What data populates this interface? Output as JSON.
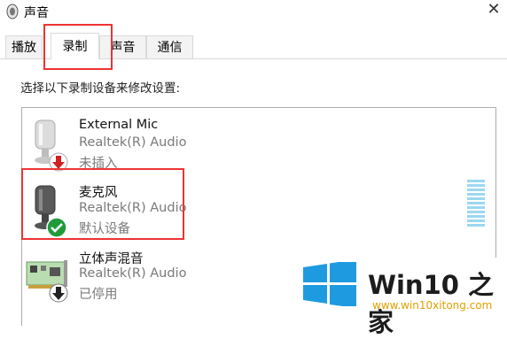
{
  "window": {
    "title": "声音",
    "close_glyph": "✕"
  },
  "tabs": [
    {
      "label": "播放"
    },
    {
      "label": "录制"
    },
    {
      "label": "声音"
    },
    {
      "label": "通信"
    }
  ],
  "instruction": "选择以下录制设备来修改设置:",
  "devices": [
    {
      "name": "External Mic",
      "driver": "Realtek(R) Audio",
      "status": "未插入",
      "icon": "microphone-icon",
      "badge": "unplugged-red-arrow-icon"
    },
    {
      "name": "麦克风",
      "driver": "Realtek(R) Audio",
      "status": "默认设备",
      "icon": "microphone-icon",
      "badge": "default-green-check-icon"
    },
    {
      "name": "立体声混音",
      "driver": "Realtek(R) Audio",
      "status": "已停用",
      "icon": "sound-card-icon",
      "badge": "disabled-down-arrow-icon"
    }
  ],
  "watermark": {
    "brand": "Win10 之家",
    "url": "www.win10xitong.com"
  },
  "colors": {
    "highlight_box": "#e33333",
    "default_check": "#1f9b3a",
    "unplugged_arrow": "#d02020",
    "level_meter": "#9cd7f2",
    "win_logo": "#1e9be0"
  }
}
